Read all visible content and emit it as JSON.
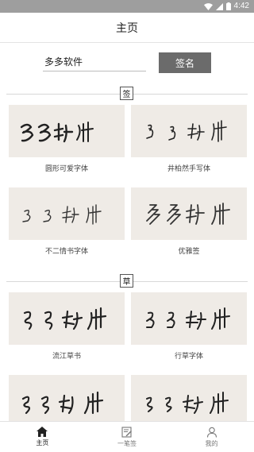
{
  "status_bar": {
    "time": "4:42"
  },
  "app_bar": {
    "title": "主页"
  },
  "search": {
    "input_value": "多多软件",
    "button_label": "签名"
  },
  "sections": [
    {
      "badge": "签",
      "styles": [
        {
          "caption": "圆形可爱字体",
          "sample": "多多软件"
        },
        {
          "caption": "井柏然手写体",
          "sample": "多多软件"
        },
        {
          "caption": "不二情书字体",
          "sample": "多多软件"
        },
        {
          "caption": "优雅签",
          "sample": "多多软件"
        }
      ]
    },
    {
      "badge": "草",
      "styles": [
        {
          "caption": "流江草书",
          "sample": "多多软件"
        },
        {
          "caption": "行草字体",
          "sample": "多多软件"
        },
        {
          "caption": "",
          "sample": "多多软件"
        },
        {
          "caption": "",
          "sample": "多多软件"
        }
      ]
    }
  ],
  "bottom_nav": {
    "home": "主页",
    "one_stroke": "一笔签",
    "mine": "我的"
  },
  "colors": {
    "status_bar": "#9e9e9e",
    "button": "#6b6b6b",
    "thumb_bg": "#efebe6"
  }
}
